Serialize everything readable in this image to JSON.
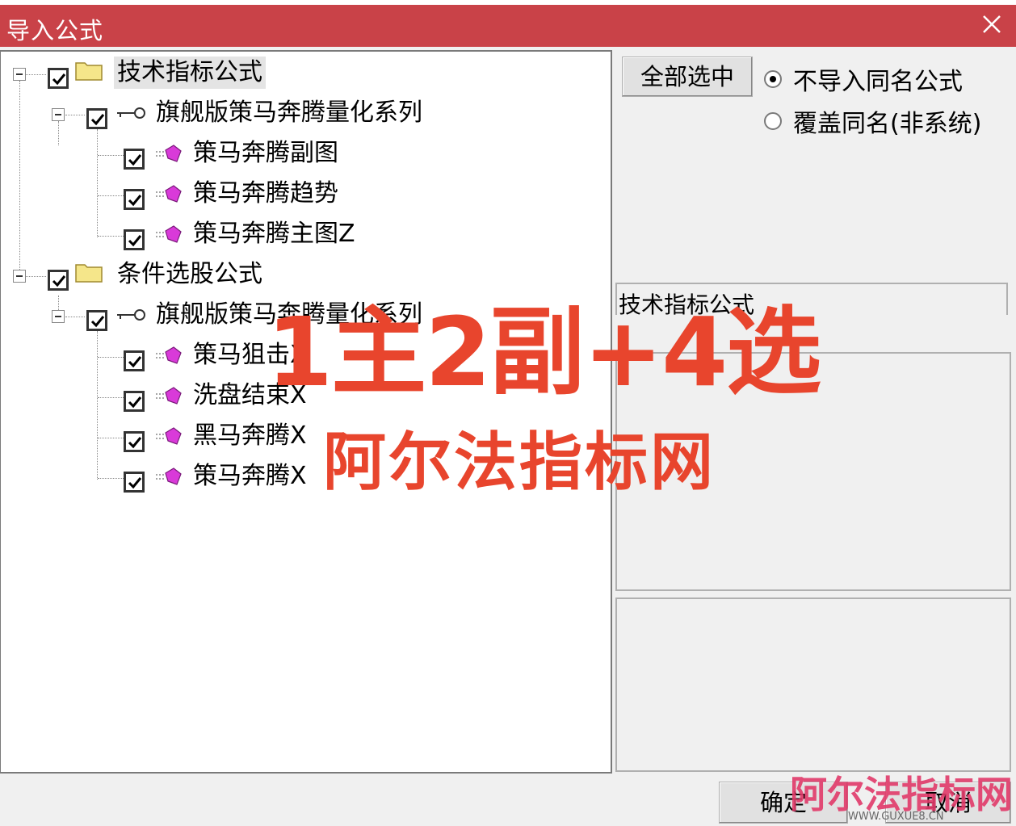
{
  "window": {
    "title": "导入公式",
    "close_icon": "close-icon"
  },
  "tree": {
    "groups": [
      {
        "label": "技术指标公式",
        "icon": "folder-icon",
        "checked": true,
        "series": {
          "label": "旗舰版策马奔腾量化系列",
          "icon": "key-icon",
          "checked": true,
          "items": [
            {
              "label": "策马奔腾副图",
              "icon": "formula-gem-icon",
              "checked": true
            },
            {
              "label": "策马奔腾趋势",
              "icon": "formula-gem-icon",
              "checked": true
            },
            {
              "label": "策马奔腾主图Z",
              "icon": "formula-gem-icon",
              "checked": true
            }
          ]
        }
      },
      {
        "label": "条件选股公式",
        "icon": "folder-icon",
        "checked": true,
        "series": {
          "label": "旗舰版策马奔腾量化系列",
          "icon": "key-icon",
          "checked": true,
          "items": [
            {
              "label": "策马狙击X",
              "icon": "formula-gem-icon",
              "checked": true
            },
            {
              "label": "洗盘结束X",
              "icon": "formula-gem-icon",
              "checked": true
            },
            {
              "label": "黑马奔腾X",
              "icon": "formula-gem-icon",
              "checked": true
            },
            {
              "label": "策马奔腾X",
              "icon": "formula-gem-icon",
              "checked": true
            }
          ]
        }
      }
    ]
  },
  "right": {
    "select_all_label": "全部选中",
    "options": [
      {
        "label": "不导入同名公式",
        "selected": true
      },
      {
        "label": "覆盖同名(非系统)",
        "selected": false
      }
    ],
    "info_title": "技术指标公式"
  },
  "footer": {
    "ok_label": "确定",
    "cancel_label": "取消"
  },
  "watermark": {
    "headline": "1主2副+4选",
    "site": "阿尔法指标网",
    "corner": "阿尔法指标网",
    "url": "WWW.GUXUE8.CN"
  },
  "colors": {
    "title_bar": "#c94248",
    "watermark": "#e8452d"
  }
}
